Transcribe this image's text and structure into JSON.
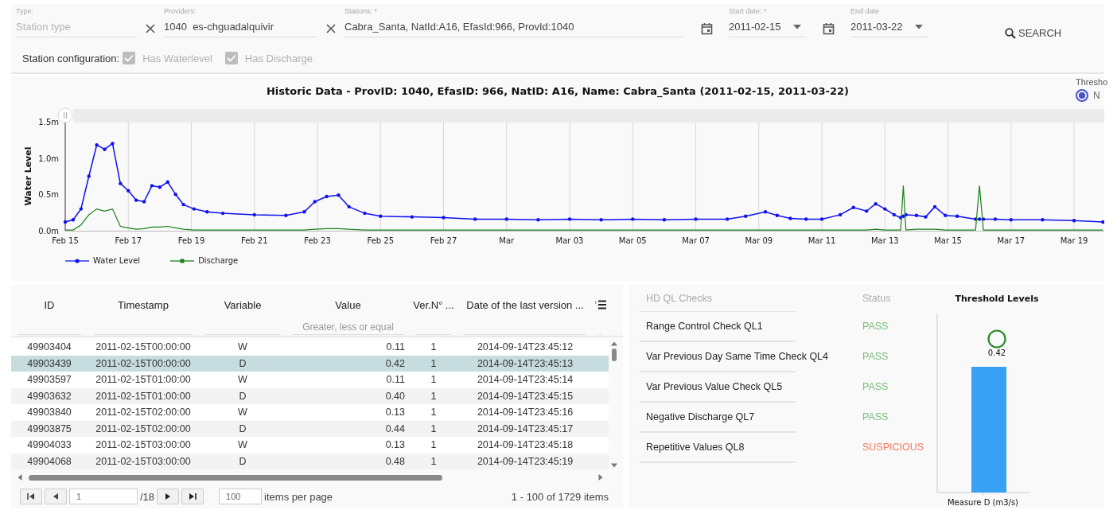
{
  "filters": {
    "type": {
      "label": "Type:",
      "placeholder": "Station type"
    },
    "providers": {
      "label": "Providers:",
      "value": "1040  es-chguadalquivir"
    },
    "stations": {
      "label": "Stations: *",
      "value": "Cabra_Santa, NatId:A16, EfasId:966, ProvId:1040"
    },
    "start_date": {
      "label": "Start date: *",
      "value": "2011-02-15"
    },
    "end_date": {
      "label": "End date",
      "value": "2011-03-22"
    },
    "search_button": "SEARCH"
  },
  "station_configuration": {
    "label": "Station configuration:",
    "options": [
      {
        "label": "Has Waterlevel",
        "checked": true,
        "disabled": true
      },
      {
        "label": "Has Discharge",
        "checked": true,
        "disabled": true
      }
    ]
  },
  "historic_chart": {
    "threshold_label": "Thresho",
    "threshold_option": {
      "label": "N",
      "selected": true
    },
    "chart_data": {
      "type": "line",
      "title": "Historic Data - ProvID: 1040, EfasID: 966, NatID: A16, Name: Cabra_Santa (2011-02-15, 2011-03-22)",
      "ylabel": "Water Level",
      "x": [
        "2011-02-15T00:00",
        "2011-02-15T06:00",
        "2011-02-15T12:00",
        "2011-02-15T18:00",
        "2011-02-16T00:00",
        "2011-02-16T06:00",
        "2011-02-16T12:00",
        "2011-02-16T18:00",
        "2011-02-17T00:00",
        "2011-02-17T06:00",
        "2011-02-17T12:00",
        "2011-02-17T18:00",
        "2011-02-18T00:00",
        "2011-02-18T06:00",
        "2011-02-18T12:00",
        "2011-02-18T18:00",
        "2011-02-19T02:00",
        "2011-02-19T12:00",
        "2011-02-20T00:00",
        "2011-02-21T00:00",
        "2011-02-22T00:00",
        "2011-02-22T14:00",
        "2011-02-22T22:00",
        "2011-02-23T07:00",
        "2011-02-23T16:00",
        "2011-02-24T00:00",
        "2011-02-24T12:00",
        "2011-02-25T00:00",
        "2011-02-26T00:00",
        "2011-02-27T00:00",
        "2011-02-28T00:00",
        "2011-03-01T00:00",
        "2011-03-02T00:00",
        "2011-03-03T00:00",
        "2011-03-04T00:00",
        "2011-03-05T00:00",
        "2011-03-06T00:00",
        "2011-03-07T00:00",
        "2011-03-08T00:00",
        "2011-03-08T14:00",
        "2011-03-09T05:00",
        "2011-03-09T14:00",
        "2011-03-10T00:00",
        "2011-03-10T12:00",
        "2011-03-11T00:00",
        "2011-03-11T14:00",
        "2011-03-12T00:00",
        "2011-03-12T10:00",
        "2011-03-12T17:00",
        "2011-03-13T00:00",
        "2011-03-13T07:00",
        "2011-03-13T12:00",
        "2011-03-13T14:00",
        "2011-03-13T16:00",
        "2011-03-14T00:00",
        "2011-03-14T07:00",
        "2011-03-14T14:00",
        "2011-03-14T22:00",
        "2011-03-15T07:00",
        "2011-03-15T21:00",
        "2011-03-16T00:00",
        "2011-03-16T03:00",
        "2011-03-16T12:00",
        "2011-03-17T00:00",
        "2011-03-18T00:00",
        "2011-03-19T00:00",
        "2011-03-19T22:00"
      ],
      "series": [
        {
          "name": "Water Level",
          "color": "#1010f0",
          "values": [
            0.12,
            0.15,
            0.3,
            0.75,
            1.18,
            1.12,
            1.2,
            0.65,
            0.55,
            0.42,
            0.4,
            0.62,
            0.6,
            0.67,
            0.5,
            0.36,
            0.3,
            0.26,
            0.24,
            0.22,
            0.21,
            0.26,
            0.4,
            0.47,
            0.49,
            0.33,
            0.24,
            0.2,
            0.19,
            0.18,
            0.16,
            0.16,
            0.15,
            0.16,
            0.15,
            0.16,
            0.15,
            0.16,
            0.16,
            0.2,
            0.26,
            0.21,
            0.17,
            0.16,
            0.16,
            0.22,
            0.32,
            0.27,
            0.37,
            0.3,
            0.22,
            0.18,
            0.2,
            0.22,
            0.21,
            0.19,
            0.33,
            0.21,
            0.2,
            0.16,
            0.16,
            0.16,
            0.16,
            0.15,
            0.15,
            0.14,
            0.12
          ]
        },
        {
          "name": "Discharge",
          "color": "#1a7f1a",
          "values": [
            0.01,
            0.01,
            0.08,
            0.22,
            0.3,
            0.27,
            0.3,
            0.06,
            0.04,
            0.02,
            0.03,
            0.05,
            0.05,
            0.06,
            0.04,
            0.02,
            0.01,
            0.01,
            0.01,
            0.01,
            0.01,
            0.01,
            0.02,
            0.03,
            0.03,
            0.02,
            0.01,
            0.01,
            0.01,
            0.01,
            0.01,
            0.01,
            0.01,
            0.01,
            0.01,
            0.01,
            0.01,
            0.01,
            0.01,
            0.01,
            0.01,
            0.01,
            0.01,
            0.01,
            0.01,
            0.01,
            0.01,
            0.01,
            0.02,
            0.01,
            0.01,
            0.01,
            0.62,
            0.01,
            0.02,
            0.02,
            0.02,
            0.01,
            0.01,
            0.01,
            0.62,
            0.01,
            0.01,
            0.01,
            0.01,
            0.01,
            0.01
          ]
        }
      ],
      "xlim": [
        "2011-02-15T00:00",
        "2011-03-19T23:00"
      ],
      "ylim": [
        0,
        1.5
      ],
      "grid": "x",
      "legend": "bottom-left",
      "xticks": [
        {
          "value": "2011-02-15T00:00",
          "label": "Feb 15"
        },
        {
          "value": "2011-02-17T00:00",
          "label": "Feb 17"
        },
        {
          "value": "2011-02-19T00:00",
          "label": "Feb 19"
        },
        {
          "value": "2011-02-21T00:00",
          "label": "Feb 21"
        },
        {
          "value": "2011-02-23T00:00",
          "label": "Feb 23"
        },
        {
          "value": "2011-02-25T00:00",
          "label": "Feb 25"
        },
        {
          "value": "2011-02-27T00:00",
          "label": "Feb 27"
        },
        {
          "value": "2011-03-01T00:00",
          "label": "Mar"
        },
        {
          "value": "2011-03-03T00:00",
          "label": "Mar 03"
        },
        {
          "value": "2011-03-05T00:00",
          "label": "Mar 05"
        },
        {
          "value": "2011-03-07T00:00",
          "label": "Mar 07"
        },
        {
          "value": "2011-03-09T00:00",
          "label": "Mar 09"
        },
        {
          "value": "2011-03-11T00:00",
          "label": "Mar 11"
        },
        {
          "value": "2011-03-13T00:00",
          "label": "Mar 13"
        },
        {
          "value": "2011-03-15T00:00",
          "label": "Mar 15"
        },
        {
          "value": "2011-03-17T00:00",
          "label": "Mar 17"
        },
        {
          "value": "2011-03-19T00:00",
          "label": "Mar 19"
        }
      ],
      "yticks": [
        {
          "value": 0,
          "label": "0.0m"
        },
        {
          "value": 0.5,
          "label": "0.5m"
        },
        {
          "value": 1,
          "label": "1.0m"
        },
        {
          "value": 1.5,
          "label": "1.5m"
        }
      ]
    }
  },
  "data_table": {
    "columns": [
      "ID",
      "Timestamp",
      "Variable",
      "Value",
      "Ver.N° ...",
      "Date of the last version ..."
    ],
    "value_filter_placeholder": "Greater, less or equal",
    "rows": [
      {
        "cells": [
          "49903404",
          "2011-02-15T00:00:00",
          "W",
          "0.11",
          "1",
          "2014-09-14T23:45:12"
        ],
        "selected": false
      },
      {
        "cells": [
          "49903439",
          "2011-02-15T00:00:00",
          "D",
          "0.42",
          "1",
          "2014-09-14T23:45:13"
        ],
        "selected": true
      },
      {
        "cells": [
          "49903597",
          "2011-02-15T01:00:00",
          "W",
          "0.11",
          "1",
          "2014-09-14T23:45:14"
        ],
        "selected": false
      },
      {
        "cells": [
          "49903632",
          "2011-02-15T01:00:00",
          "D",
          "0.40",
          "1",
          "2014-09-14T23:45:15"
        ],
        "selected": false
      },
      {
        "cells": [
          "49903840",
          "2011-02-15T02:00:00",
          "W",
          "0.13",
          "1",
          "2014-09-14T23:45:16"
        ],
        "selected": false
      },
      {
        "cells": [
          "49903875",
          "2011-02-15T02:00:00",
          "D",
          "0.44",
          "1",
          "2014-09-14T23:45:17"
        ],
        "selected": false
      },
      {
        "cells": [
          "49904033",
          "2011-02-15T03:00:00",
          "W",
          "0.13",
          "1",
          "2014-09-14T23:45:18"
        ],
        "selected": false
      },
      {
        "cells": [
          "49904068",
          "2011-02-15T03:00:00",
          "D",
          "0.48",
          "1",
          "2014-09-14T23:45:19"
        ],
        "selected": false
      }
    ],
    "pager": {
      "page": "1",
      "pages": "/18",
      "page_size": "100",
      "page_size_label": "items per page",
      "summary": "1 - 100 of 1729 items"
    }
  },
  "ql_checks": {
    "columns": [
      "HD QL Checks",
      "Status"
    ],
    "rows": [
      {
        "name": "Range Control Check QL1",
        "status": "PASS",
        "color": "#7cbb7c"
      },
      {
        "name": "Var Previous Day Same Time Check QL4",
        "status": "PASS",
        "color": "#7cbb7c"
      },
      {
        "name": "Var Previous Value Check QL5",
        "status": "PASS",
        "color": "#7cbb7c"
      },
      {
        "name": "Negative Discharge QL7",
        "status": "PASS",
        "color": "#7cbb7c"
      },
      {
        "name": "Repetitive Values QL8",
        "status": "SUSPICIOUS",
        "color": "#f27b62"
      }
    ]
  },
  "threshold_chart": {
    "title": "Threshold Levels",
    "marker_label": "0.42",
    "category": "Measure D (m3/s)"
  }
}
